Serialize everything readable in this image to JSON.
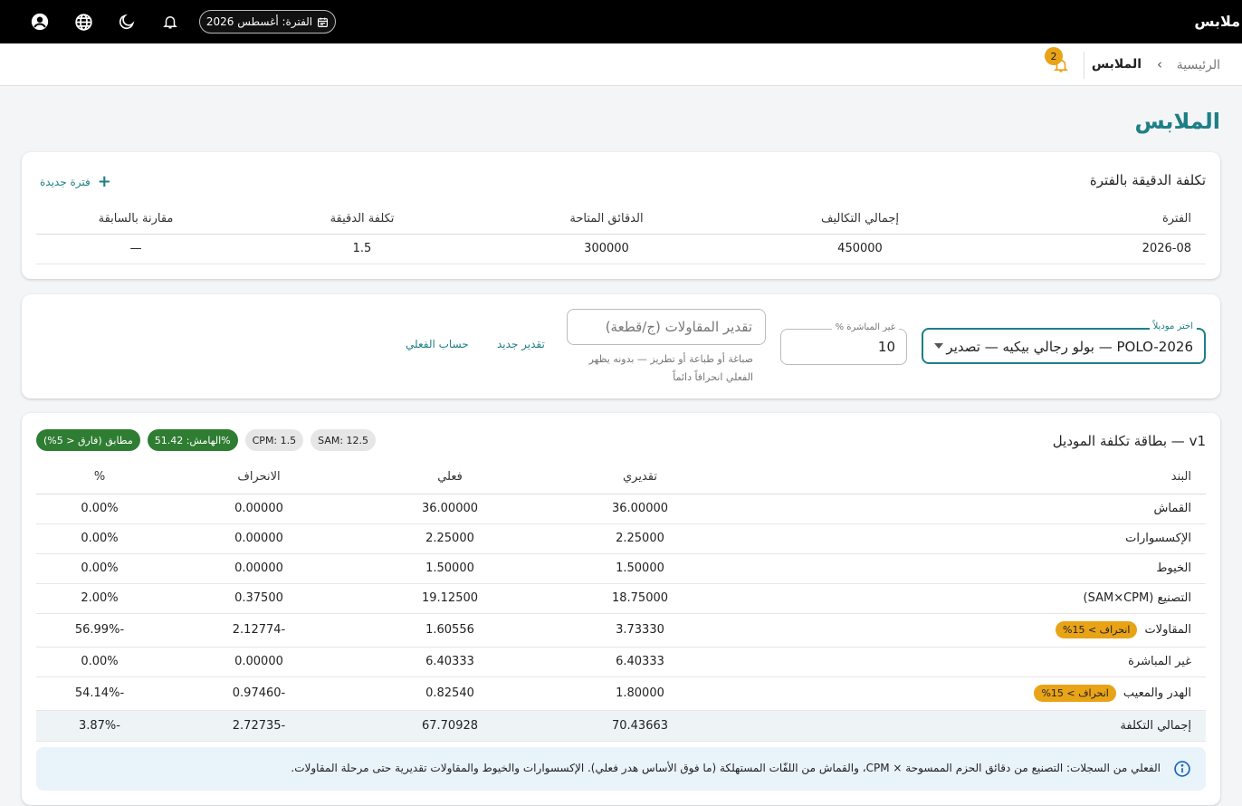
{
  "topbar": {
    "app_title": "ملابس",
    "period_label": "الفترة: أغسطس 2026",
    "icons": [
      "account-icon",
      "globe-icon",
      "moon-icon",
      "bell-icon",
      "calendar-icon"
    ]
  },
  "breadcrumb": {
    "home": "الرئيسية",
    "current": "الملابس",
    "notifications_count": "2"
  },
  "page": {
    "title": "الملابس"
  },
  "minute_cost_card": {
    "title": "تكلفة الدقيقة بالفترة",
    "new_period_label": "فترة جديدة",
    "columns": [
      "الفترة",
      "إجمالي التكاليف",
      "الدقائق المتاحة",
      "تكلفة الدقيقة",
      "مقارنة بالسابقة"
    ],
    "rows": [
      [
        "2026-08",
        "450000",
        "300000",
        "1.5",
        "—"
      ]
    ]
  },
  "estimate_card": {
    "model_legend": "اختر موديلاً",
    "model_value": "POLO-2026 — بولو رجالي بيكيه — تصدير",
    "overhead_legend": "غير المباشرة %",
    "overhead_value": "10",
    "contract_placeholder": "تقدير المقاولات (ج/قطعة)",
    "contract_helper": "صباغة أو طباعة أو تطريز — بدونه يظهر الفعلي انحرافاً دائماً",
    "new_estimate_label": "تقدير جديد",
    "actual_calc_label": "حساب الفعلي"
  },
  "model_cost_card": {
    "title": "بطاقة تكلفة الموديل — v1",
    "chips": {
      "sam": "SAM: 12.5",
      "cpm": "CPM: 1.5",
      "margin": "الهامش: 51.42%",
      "match": "مطابق (فارق < 5%)"
    },
    "colors": {
      "match": "#2e7d32",
      "deviation": "#e8a317",
      "accent": "#1e7f86"
    },
    "columns": [
      "البند",
      "تقديري",
      "فعلي",
      "الانحراف",
      "%"
    ],
    "deviation_badge": "انحراف > 15%",
    "rows": [
      {
        "item": "القماش",
        "estimated": "36.00000",
        "actual": "36.00000",
        "deviation": "0.00000",
        "pct": "0.00%"
      },
      {
        "item": "الإكسسوارات",
        "estimated": "2.25000",
        "actual": "2.25000",
        "deviation": "0.00000",
        "pct": "0.00%"
      },
      {
        "item": "الخيوط",
        "estimated": "1.50000",
        "actual": "1.50000",
        "deviation": "0.00000",
        "pct": "0.00%"
      },
      {
        "item": "التصنيع (SAM×CPM)",
        "estimated": "18.75000",
        "actual": "19.12500",
        "deviation": "0.37500",
        "pct": "2.00%"
      },
      {
        "item": "المقاولات",
        "estimated": "3.73330",
        "actual": "1.60556",
        "deviation": "-2.12774",
        "pct": "-56.99%"
      },
      {
        "item": "غير المباشرة",
        "estimated": "6.40333",
        "actual": "6.40333",
        "deviation": "0.00000",
        "pct": "0.00%"
      },
      {
        "item": "الهدر والمعيب",
        "estimated": "1.80000",
        "actual": "0.82540",
        "deviation": "-0.97460",
        "pct": "-54.14%"
      }
    ],
    "total": {
      "item": "إجمالي التكلفة",
      "estimated": "70.43663",
      "actual": "67.70928",
      "deviation": "-2.72735",
      "pct": "-3.87%"
    },
    "info_text": "الفعلي من السجلات: التصنيع من دقائق الحزم الممسوحة × CPM، والقماش من اللفّات المستهلكة (ما فوق الأساس هدر فعلي). الإكسسوارات والخيوط والمقاولات تقديرية حتى مرحلة المقاولات."
  }
}
